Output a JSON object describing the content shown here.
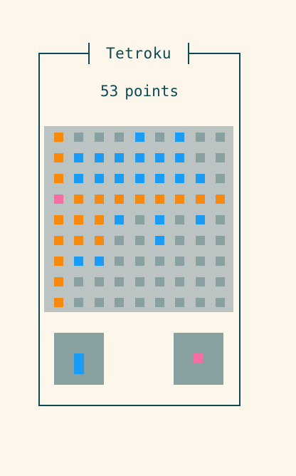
{
  "title": "Tetroku",
  "score": {
    "value": "53",
    "label": "points"
  },
  "colors": {
    "background": "#fdf6eb",
    "frame": "#0d4a57",
    "board": "#bcc3c3",
    "empty": "#89a0a0",
    "orange": "#f7890f",
    "blue": "#1a9bf5",
    "pink": "#f56da3"
  },
  "board": {
    "legend": {
      "e": "empty",
      "o": "orange",
      "b": "blue",
      "p": "pink"
    },
    "rows": [
      [
        "o",
        "e",
        "e",
        "e",
        "b",
        "e",
        "b",
        "e",
        "e"
      ],
      [
        "o",
        "b",
        "b",
        "b",
        "b",
        "b",
        "b",
        "e",
        "e"
      ],
      [
        "o",
        "b",
        "b",
        "b",
        "b",
        "b",
        "b",
        "b",
        "e"
      ],
      [
        "p",
        "o",
        "o",
        "o",
        "o",
        "o",
        "o",
        "o",
        "o"
      ],
      [
        "o",
        "o",
        "o",
        "b",
        "e",
        "b",
        "e",
        "b",
        "e"
      ],
      [
        "o",
        "o",
        "o",
        "e",
        "e",
        "b",
        "e",
        "e",
        "e"
      ],
      [
        "o",
        "b",
        "b",
        "e",
        "e",
        "e",
        "e",
        "e",
        "e"
      ],
      [
        "o",
        "e",
        "e",
        "e",
        "e",
        "e",
        "e",
        "e",
        "e"
      ],
      [
        "o",
        "e",
        "e",
        "e",
        "e",
        "e",
        "e",
        "e",
        "e"
      ]
    ]
  },
  "next_pieces": [
    {
      "name": "blue-vertical-piece",
      "color": "blue"
    },
    {
      "name": "pink-single-piece",
      "color": "pink"
    }
  ]
}
